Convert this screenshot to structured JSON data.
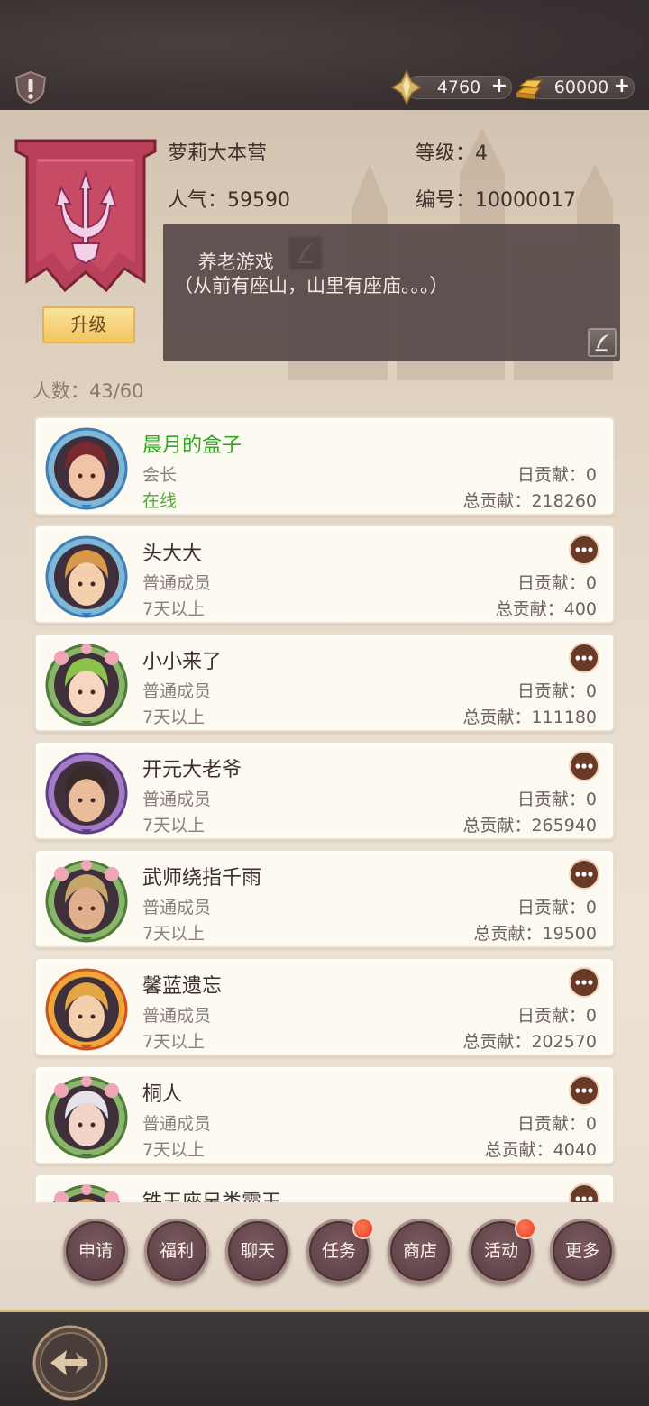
{
  "header": {
    "resources": [
      {
        "name": "crystal",
        "icon": "crystal-icon",
        "value": "4760",
        "plus": "+"
      },
      {
        "name": "gold",
        "icon": "gold-bars-icon",
        "value": "60000",
        "plus": "+"
      }
    ]
  },
  "guild": {
    "name": "萝莉大本营",
    "level_label": "等级：4",
    "popularity_label": "人气：59590",
    "id_label": "编号：10000017",
    "notice": "养老游戏\n（从前有座山，山里有座庙。。。）",
    "upgrade_label": "升级",
    "members_count": "人数：43/60"
  },
  "members": [
    {
      "name": "晨月的盒子",
      "role": "会长",
      "status": "在线",
      "daily": "日贡献：0",
      "total": "总贡献：218260",
      "leader": true,
      "online": true,
      "frame": "blue",
      "hair": "#7a2a2e",
      "skin": "#f1c4a6"
    },
    {
      "name": "头大大",
      "role": "普通成员",
      "status": "7天以上",
      "daily": "日贡献：0",
      "total": "总贡献：400",
      "leader": false,
      "online": false,
      "frame": "blue",
      "hair": "#d89a4a",
      "skin": "#f4cfae"
    },
    {
      "name": "小小来了",
      "role": "普通成员",
      "status": "7天以上",
      "daily": "日贡献：0",
      "total": "总贡献：111180",
      "leader": false,
      "online": false,
      "frame": "flower",
      "hair": "#8cc24a",
      "skin": "#f6d6bf"
    },
    {
      "name": "开元大老爷",
      "role": "普通成员",
      "status": "7天以上",
      "daily": "日贡献：0",
      "total": "总贡献：265940",
      "leader": false,
      "online": false,
      "frame": "purple",
      "hair": "#3a2a2a",
      "skin": "#e9bc9a"
    },
    {
      "name": "武师绕指千雨",
      "role": "普通成员",
      "status": "7天以上",
      "daily": "日贡献：0",
      "total": "总贡献：19500",
      "leader": false,
      "online": false,
      "frame": "flower",
      "hair": "#c6a56a",
      "skin": "#e0b08e"
    },
    {
      "name": "馨蓝遗忘",
      "role": "普通成员",
      "status": "7天以上",
      "daily": "日贡献：0",
      "total": "总贡献：202570",
      "leader": false,
      "online": false,
      "frame": "fire",
      "hair": "#e3a645",
      "skin": "#f4cfae"
    },
    {
      "name": "桐人",
      "role": "普通成员",
      "status": "7天以上",
      "daily": "日贡献：0",
      "total": "总贡献：4040",
      "leader": false,
      "online": false,
      "frame": "flower",
      "hair": "#e6e2ea",
      "skin": "#f1d3c8"
    },
    {
      "name": "铁王座另类霸王",
      "role": "",
      "status": "",
      "daily": "",
      "total": "",
      "leader": false,
      "online": false,
      "frame": "flower",
      "hair": "#d89a4a",
      "skin": "#f4cfae"
    }
  ],
  "actions": [
    {
      "label": "申请",
      "badge": false
    },
    {
      "label": "福利",
      "badge": false
    },
    {
      "label": "聊天",
      "badge": false
    },
    {
      "label": "任务",
      "badge": true
    },
    {
      "label": "商店",
      "badge": false
    },
    {
      "label": "活动",
      "badge": true
    },
    {
      "label": "更多",
      "badge": false
    }
  ],
  "colors": {
    "leader_name": "#2ea81f",
    "online": "#58a73a",
    "upgrade": "#f1c562",
    "round_button": "#60444a"
  }
}
